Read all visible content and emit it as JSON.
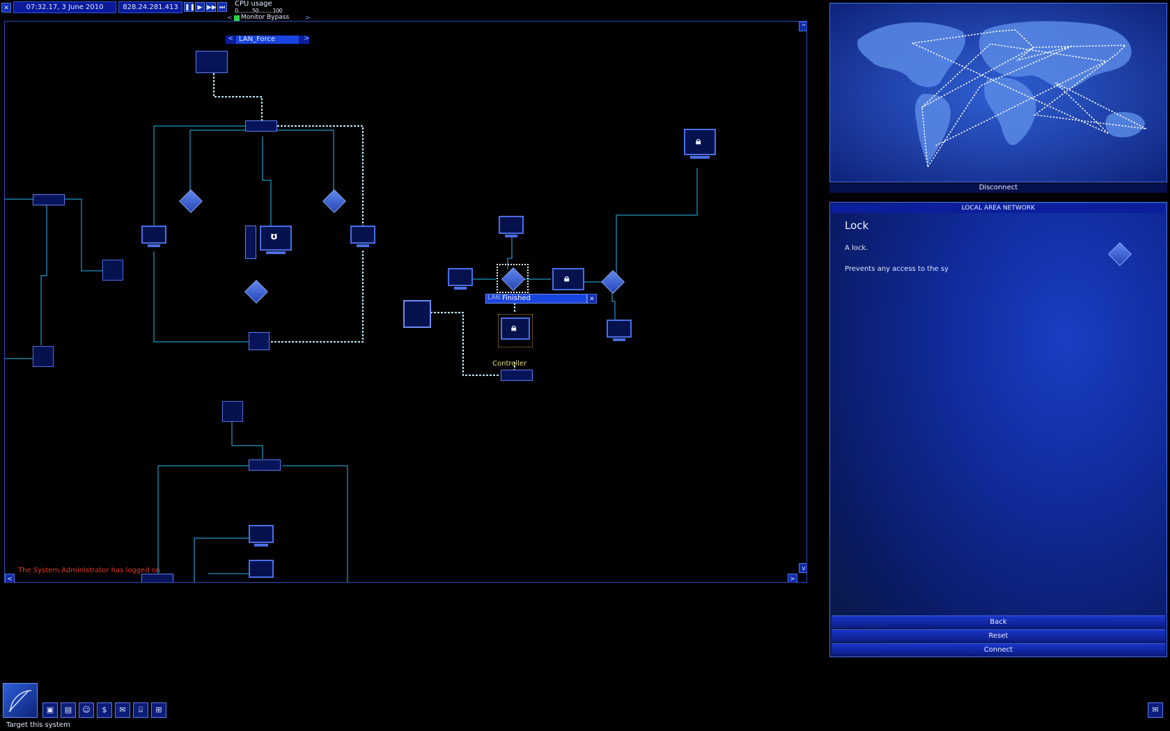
{
  "topbar": {
    "clock": "07:32.17, 3 June 2010",
    "ip_address": "828.24.281.413",
    "cpu_label": "CPU usage",
    "cpu_scale": "0..........50..........100",
    "monitor_label": "Monitor Bypass",
    "tab_label": "LAN_Force"
  },
  "lan": {
    "progress_text": "Finished",
    "progress_prefix": "LAN",
    "controller_label": "Controller",
    "log_message": "The System Administrator has logged on"
  },
  "map": {
    "disconnect_label": "Disconnect"
  },
  "info": {
    "header": "LOCAL AREA NETWORK",
    "title": "Lock",
    "subtitle": "A lock.",
    "description": "Prevents any access to the sy",
    "back_label": "Back",
    "reset_label": "Reset",
    "connect_label": "Connect"
  },
  "status": {
    "hint": "Target this system"
  },
  "icons": {
    "close": "close-icon",
    "pause": "pause-icon",
    "play": "play-icon",
    "fast": "fast-forward-icon",
    "fastest": "fastest-icon",
    "mail": "mail-icon"
  },
  "colors": {
    "accent": "#2e57d8",
    "connection": "#1b7ea3",
    "active_link": "#bff3ff",
    "log_red": "#e03a28",
    "controller_text": "#e8e070"
  }
}
